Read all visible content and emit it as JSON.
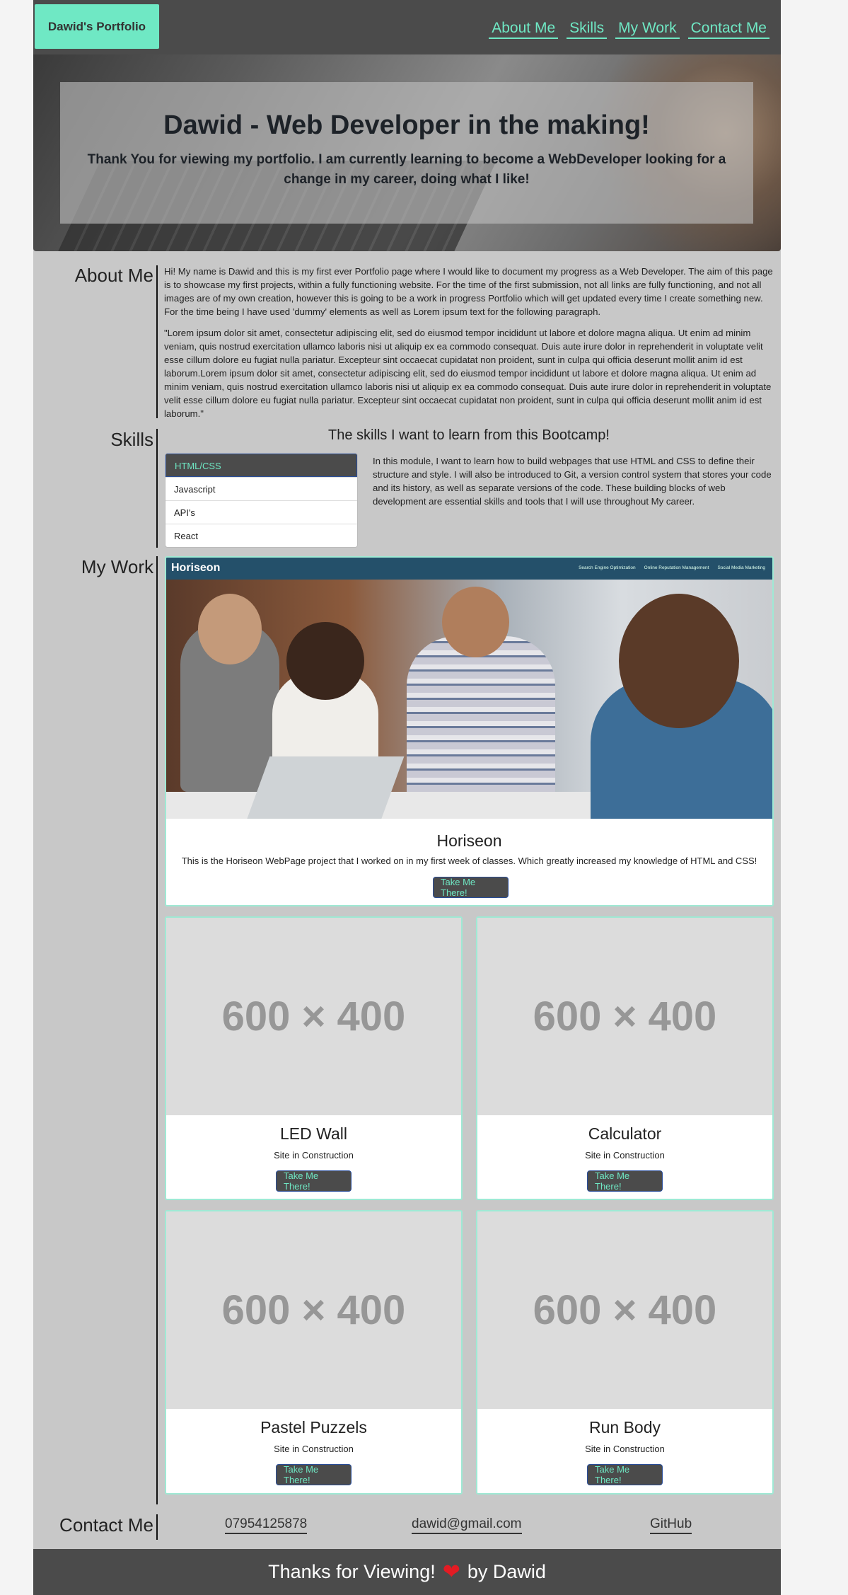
{
  "header": {
    "brand": "Dawid's Portfolio",
    "nav": [
      "About Me",
      "Skills",
      "My Work",
      "Contact Me"
    ]
  },
  "hero": {
    "title": "Dawid - Web Developer in the making!",
    "subtitle": "Thank You for viewing my portfolio. I am currently learning to become a WebDeveloper looking for a change in my career, doing what I like!"
  },
  "about": {
    "heading": "About Me",
    "paragraphs": [
      "Hi! My name is Dawid and this is my first ever Portfolio page where I would like to document my progress as a Web Developer. The aim of this page is to showcase my first projects, within a fully functioning website. For the time of the first submission, not all links are fully functioning, and not all images are of my own creation, however this is going to be a work in progress Portfolio which will get updated every time I create something new. For the time being I have used 'dummy' elements as well as Lorem ipsum text for the following paragraph.",
      "\"Lorem ipsum dolor sit amet, consectetur adipiscing elit, sed do eiusmod tempor incididunt ut labore et dolore magna aliqua. Ut enim ad minim veniam, quis nostrud exercitation ullamco laboris nisi ut aliquip ex ea commodo consequat. Duis aute irure dolor in reprehenderit in voluptate velit esse cillum dolore eu fugiat nulla pariatur. Excepteur sint occaecat cupidatat non proident, sunt in culpa qui officia deserunt mollit anim id est laborum.Lorem ipsum dolor sit amet, consectetur adipiscing elit, sed do eiusmod tempor incididunt ut labore et dolore magna aliqua. Ut enim ad minim veniam, quis nostrud exercitation ullamco laboris nisi ut aliquip ex ea commodo consequat. Duis aute irure dolor in reprehenderit in voluptate velit esse cillum dolore eu fugiat nulla pariatur. Excepteur sint occaecat cupidatat non proident, sunt in culpa qui officia deserunt mollit anim id est laborum.\""
    ]
  },
  "skills": {
    "heading": "Skills",
    "title": "The skills I want to learn from this Bootcamp!",
    "items": [
      "HTML/CSS",
      "Javascript",
      "API's",
      "React"
    ],
    "active_index": 0,
    "description": "In this module, I want to learn how to build webpages that use HTML and CSS to define their structure and style. I will also be introduced to Git, a version control system that stores your code and its history, as well as separate versions of the code. These building blocks of web development are essential skills and tools that I will use throughout My career."
  },
  "work": {
    "heading": "My Work",
    "featured": {
      "preview_logo": "Horiseon",
      "preview_links": [
        "Search Engine Optimization",
        "Online Reputation Management",
        "Social Media Marketing"
      ],
      "title": "Horiseon",
      "text": "This is the Horiseon WebPage project that I worked on in my first week of classes. Which greatly increased my knowledge of HTML and CSS!",
      "button": "Take Me There!"
    },
    "projects": [
      {
        "placeholder": "600 × 400",
        "title": "LED Wall",
        "text": "Site in Construction",
        "button": "Take Me There!"
      },
      {
        "placeholder": "600 × 400",
        "title": "Calculator",
        "text": "Site in Construction",
        "button": "Take Me There!"
      },
      {
        "placeholder": "600 × 400",
        "title": "Pastel Puzzels",
        "text": "Site in Construction",
        "button": "Take Me There!"
      },
      {
        "placeholder": "600 × 400",
        "title": "Run Body",
        "text": "Site in Construction",
        "button": "Take Me There!"
      }
    ]
  },
  "contact": {
    "heading": "Contact Me",
    "phone": "07954125878",
    "email": "dawid@gmail.com",
    "github": "GitHub"
  },
  "footer": {
    "text_before": "Thanks for Viewing!",
    "heart_icon": "heart-icon",
    "text_after": "by Dawid"
  },
  "colors": {
    "accent": "#6fe8c4",
    "header_bg": "#4b4b4b",
    "page_bg": "#c8c8c8",
    "heart": "#e31b23"
  }
}
